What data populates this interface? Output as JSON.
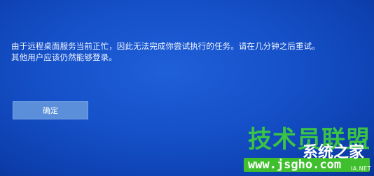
{
  "dialog": {
    "message_line1": "由于远程桌面服务当前正忙，因此无法完成你尝试执行的任务。请在几分钟之后重试。",
    "message_line2": "其他用户应该仍然能够登录。",
    "ok_label": "确定"
  },
  "watermark": {
    "brand": "技术员联盟",
    "site_name": "系统之家",
    "url": "www.jsgho.com",
    "suffix": "IA.NET"
  }
}
